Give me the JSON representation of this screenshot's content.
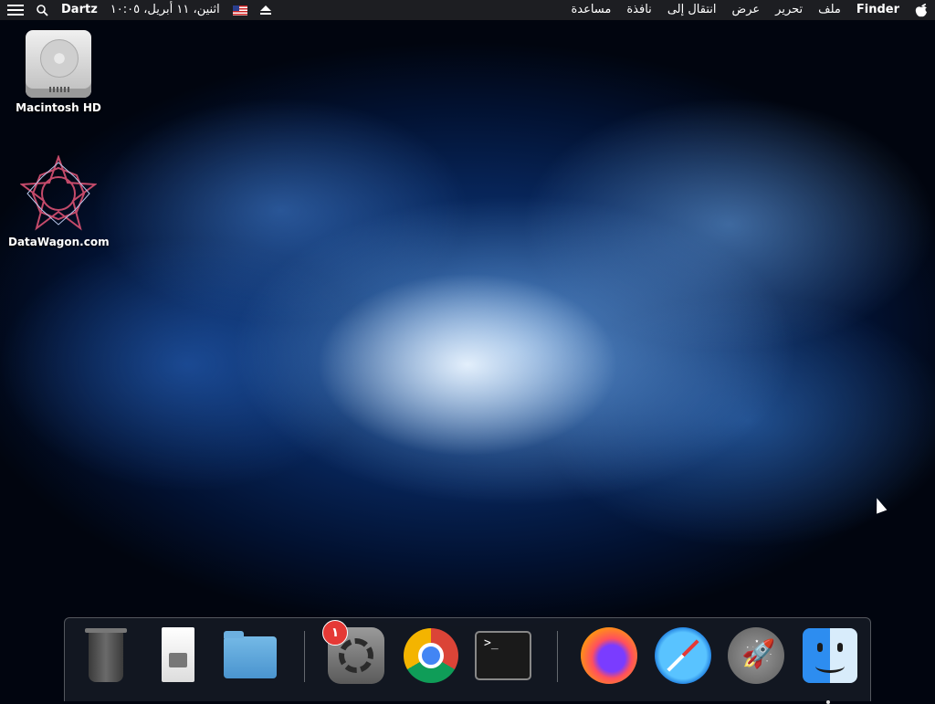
{
  "menubar": {
    "apple_icon": "apple-icon",
    "app_name": "Finder",
    "menus": [
      "ملف",
      "تحرير",
      "عرض",
      "انتقال إلى",
      "نافذة",
      "مساعدة"
    ],
    "eject_icon": "eject-icon",
    "flag_icon": "us-flag-icon",
    "datetime": "اثنين، ١١ أبريل، ١٠:٠٥",
    "user": "Dartz",
    "search_icon": "magnifier-icon",
    "control_icon": "list-icon"
  },
  "desktop": {
    "icons": [
      {
        "label": "Macintosh HD",
        "icon": "hard-drive-icon"
      },
      {
        "label": "DataWagon.com",
        "icon": "geometric-star-icon"
      }
    ]
  },
  "dock": {
    "items": [
      "trash-icon",
      "document-icon",
      "utilities-folder-icon",
      "system-preferences-icon",
      "chrome-icon",
      "terminal-icon",
      "firefox-icon",
      "safari-icon",
      "launchpad-icon",
      "finder-icon"
    ],
    "system_prefs_badge": "١",
    "terminal_prompt": ">_"
  }
}
